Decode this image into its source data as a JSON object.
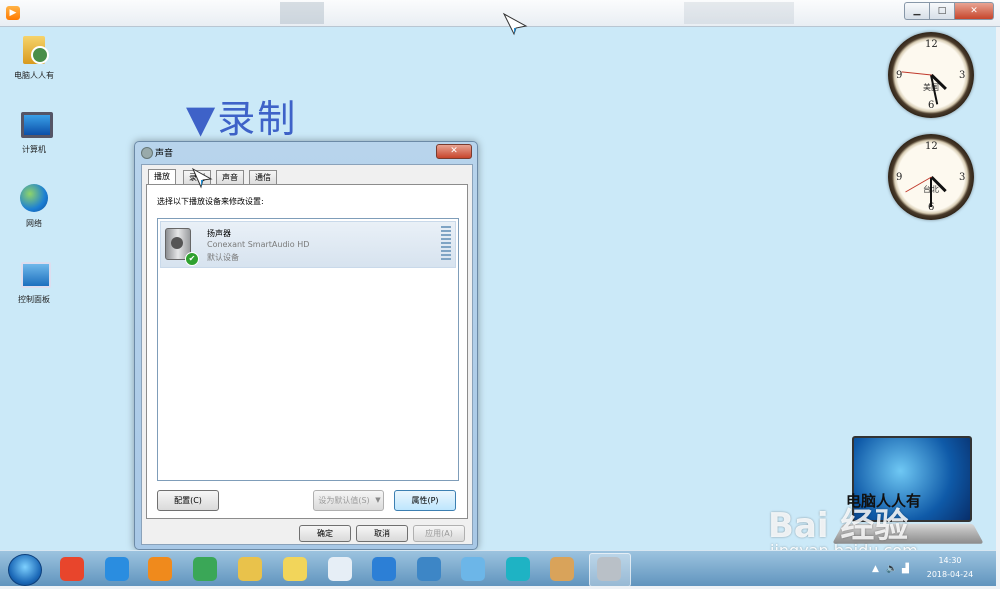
{
  "player": {
    "minimize_glyph": "▁",
    "maximize_glyph": "□",
    "close_glyph": "✕",
    "icon": "video-player-icon"
  },
  "desktop": {
    "icons": [
      {
        "label": "电脑人人有",
        "icon": "user-folder-icon"
      },
      {
        "label": "计算机",
        "icon": "computer-icon"
      },
      {
        "label": "网络",
        "icon": "network-icon"
      },
      {
        "label": "控制面板",
        "icon": "control-panel-icon"
      }
    ],
    "annotation": "▼录制"
  },
  "dialog": {
    "title": "声音",
    "close_glyph": "✕",
    "tabs": [
      "播放",
      "录制",
      "声音",
      "通信"
    ],
    "active_tab": "播放",
    "instruction": "选择以下播放设备来修改设置:",
    "device": {
      "name": "扬声器",
      "description": "Conexant SmartAudio HD",
      "status": "默认设备"
    },
    "buttons": {
      "configure": "配置(C)",
      "set_default": "设为默认值(S)",
      "properties": "属性(P)",
      "ok": "确定",
      "cancel": "取消",
      "apply": "应用(A)"
    }
  },
  "clocks": [
    {
      "city": "美国",
      "hour": 4,
      "minute": 28,
      "second": 46
    },
    {
      "city": "台北",
      "hour": 4,
      "minute": 30,
      "second": 40
    }
  ],
  "logo": {
    "text": "电脑人人有"
  },
  "watermark": {
    "brand": "Bai 经验",
    "url": "jingyan.baidu.com"
  },
  "taskbar": {
    "time": "14:30",
    "date": "2018-04-24",
    "apps": [
      {
        "icon": "game-app-icon",
        "color": "#e8452c"
      },
      {
        "icon": "ie-icon",
        "color": "#2a8de0"
      },
      {
        "icon": "media-player-icon",
        "color": "#f08a1c"
      },
      {
        "icon": "chrome-icon",
        "color": "#3aa757"
      },
      {
        "icon": "file-explorer-icon",
        "color": "#e9c24b"
      },
      {
        "icon": "folder-app-icon",
        "color": "#f2d55a"
      },
      {
        "icon": "document-icon",
        "color": "#e6eef6"
      },
      {
        "icon": "browser-icon",
        "color": "#2c7fd6"
      },
      {
        "icon": "remote-desktop-icon",
        "color": "#3d86c6"
      },
      {
        "icon": "pinwheel-icon",
        "color": "#6cb6e8"
      },
      {
        "icon": "headset-icon",
        "color": "#1eb3c4"
      },
      {
        "icon": "paint-icon",
        "color": "#d9a35a"
      },
      {
        "icon": "sound-app-icon",
        "color": "#b9c0c7"
      }
    ]
  }
}
